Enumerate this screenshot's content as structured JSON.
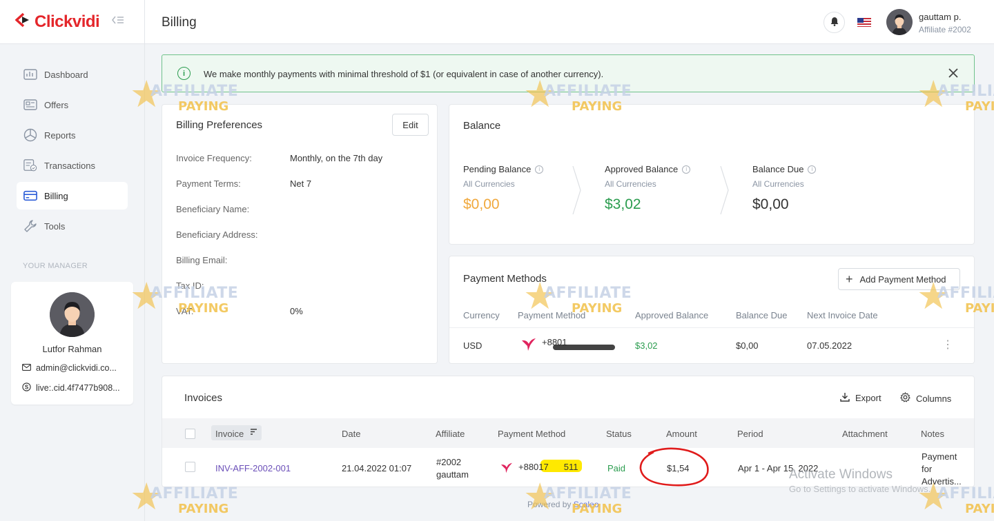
{
  "brand": {
    "name": "Clickvidi",
    "accent": "#e4262b"
  },
  "header": {
    "page_title": "Billing",
    "user_name": "gauttam p.",
    "user_sub": "Affiliate #2002"
  },
  "sidebar": {
    "items": [
      {
        "label": "Dashboard",
        "icon": "dashboard-icon"
      },
      {
        "label": "Offers",
        "icon": "offers-icon"
      },
      {
        "label": "Reports",
        "icon": "reports-icon"
      },
      {
        "label": "Transactions",
        "icon": "transactions-icon"
      },
      {
        "label": "Billing",
        "icon": "billing-icon",
        "active": true
      },
      {
        "label": "Tools",
        "icon": "tools-icon"
      }
    ],
    "manager_title": "YOUR MANAGER",
    "manager": {
      "name": "Lutfor Rahman",
      "email": "admin@clickvidi.co...",
      "skype": "live:.cid.4f7477b908..."
    }
  },
  "alert": {
    "text": "We make monthly payments with minimal threshold of $1 (or equivalent in case of another currency)."
  },
  "billing_preferences": {
    "title": "Billing Preferences",
    "edit_label": "Edit",
    "rows": [
      {
        "label": "Invoice Frequency:",
        "value": "Monthly, on the 7th day"
      },
      {
        "label": "Payment Terms:",
        "value": "Net 7"
      },
      {
        "label": "Beneficiary Name:",
        "value": ""
      },
      {
        "label": "Beneficiary Address:",
        "value": ""
      },
      {
        "label": "Billing Email:",
        "value": ""
      },
      {
        "label": "Tax ID:",
        "value": ""
      },
      {
        "label": "VAT:",
        "value": "0%"
      }
    ]
  },
  "balance": {
    "title": "Balance",
    "items": [
      {
        "label": "Pending Balance",
        "sub": "All Currencies",
        "value": "$0,00",
        "color": "#f0a83c"
      },
      {
        "label": "Approved Balance",
        "sub": "All Currencies",
        "value": "$3,02",
        "color": "#2a9c4e"
      },
      {
        "label": "Balance Due",
        "sub": "All Currencies",
        "value": "$0,00",
        "color": "#333333"
      }
    ]
  },
  "payment_methods": {
    "title": "Payment Methods",
    "add_label": "Add Payment Method",
    "columns": [
      "Currency",
      "Payment Method",
      "Approved Balance",
      "Balance Due",
      "Next Invoice Date"
    ],
    "rows": [
      {
        "currency": "USD",
        "method": "+8801",
        "approved": "$3,02",
        "due": "$0,00",
        "next_date": "07.05.2022"
      }
    ]
  },
  "invoices": {
    "title": "Invoices",
    "export_label": "Export",
    "columns_label": "Columns",
    "columns": [
      "Invoice",
      "Date",
      "Affiliate",
      "Payment Method",
      "Status",
      "Amount",
      "Period",
      "Attachment",
      "Notes"
    ],
    "rows": [
      {
        "invoice": "INV-AFF-2002-001",
        "date": "21.04.2022 01:07",
        "affiliate_id": "#2002",
        "affiliate_name": "gauttam",
        "method": "+88017",
        "method_end": "511",
        "status": "Paid",
        "amount": "$1,54",
        "period": "Apr 1 - Apr 15, 2022",
        "attachment": "",
        "notes": "Payment for Advertis..."
      }
    ]
  },
  "overlay": {
    "activate_title": "Activate Windows",
    "activate_sub": "Go to Settings to activate Windows.",
    "powered_prefix": "Powered by ",
    "powered_link": "Scaleo",
    "watermark_top": "AFFILIATE",
    "watermark_bottom": "PAYING"
  }
}
